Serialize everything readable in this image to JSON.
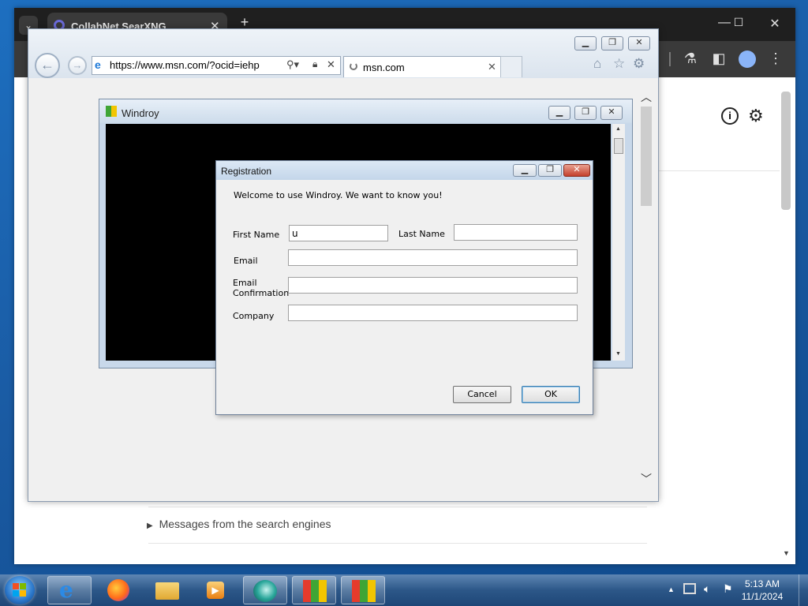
{
  "chrome": {
    "tab_title": "CollabNet SearXNG",
    "new_tab": "+",
    "result_link": "Messages from the search engines"
  },
  "ie": {
    "url": "https://www.msn.com/?ocid=iehp",
    "tab_title": "msn.com"
  },
  "windroy": {
    "title": "Windroy"
  },
  "registration": {
    "title": "Registration",
    "welcome": "Welcome to use Windroy. We want to know you!",
    "first_name_label": "First Name",
    "first_name_value": "u",
    "last_name_label": "Last Name",
    "last_name_value": "",
    "email_label": "Email",
    "email_value": "",
    "email_conf_label_1": "Email",
    "email_conf_label_2": "Confirmation",
    "email_conf_value": "",
    "company_label": "Company",
    "company_value": "",
    "cancel_label": "Cancel",
    "ok_label": "OK"
  },
  "taskbar": {
    "time": "5:13 AM",
    "date": "11/1/2024"
  }
}
